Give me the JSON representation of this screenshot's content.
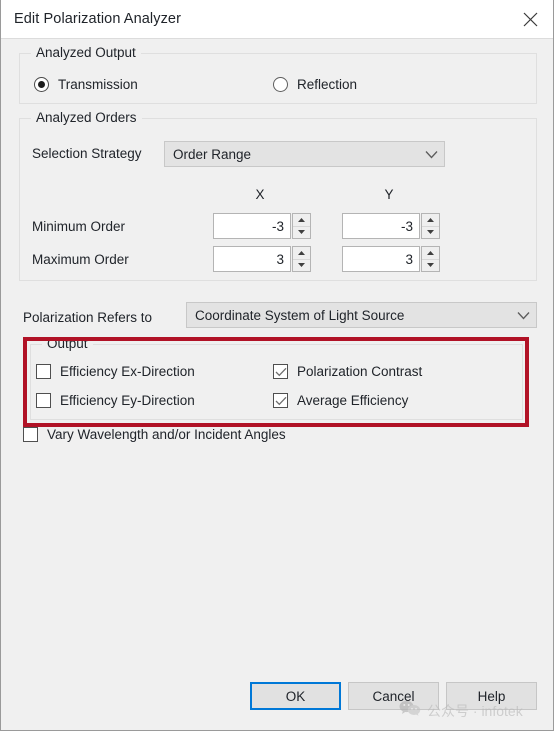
{
  "window": {
    "title": "Edit Polarization Analyzer",
    "close_icon": "close-icon"
  },
  "analyzed_output": {
    "legend": "Analyzed Output",
    "options": [
      {
        "label": "Transmission",
        "selected": true
      },
      {
        "label": "Reflection",
        "selected": false
      }
    ]
  },
  "analyzed_orders": {
    "legend": "Analyzed Orders",
    "selection_strategy_label": "Selection Strategy",
    "selection_strategy_value": "Order Range",
    "column_headers": {
      "x": "X",
      "y": "Y"
    },
    "rows": [
      {
        "label": "Minimum Order",
        "x": "-3",
        "y": "-3"
      },
      {
        "label": "Maximum Order",
        "x": "3",
        "y": "3"
      }
    ]
  },
  "polarization_refers_to": {
    "label": "Polarization Refers to",
    "value": "Coordinate System of Light Source"
  },
  "output_group": {
    "legend": "Output",
    "annotation_color": "#b11226",
    "checkboxes": [
      {
        "label": "Efficiency Ex-Direction",
        "checked": false
      },
      {
        "label": "Polarization Contrast",
        "checked": true
      },
      {
        "label": "Efficiency Ey-Direction",
        "checked": false
      },
      {
        "label": "Average Efficiency",
        "checked": true
      }
    ]
  },
  "vary": {
    "label": "Vary Wavelength and/or Incident Angles",
    "checked": false
  },
  "buttons": {
    "ok": "OK",
    "cancel": "Cancel",
    "help": "Help",
    "focus_color": "#0078d7"
  },
  "watermark": {
    "icon": "wechat-icon",
    "text": "公众号 · infotek"
  }
}
